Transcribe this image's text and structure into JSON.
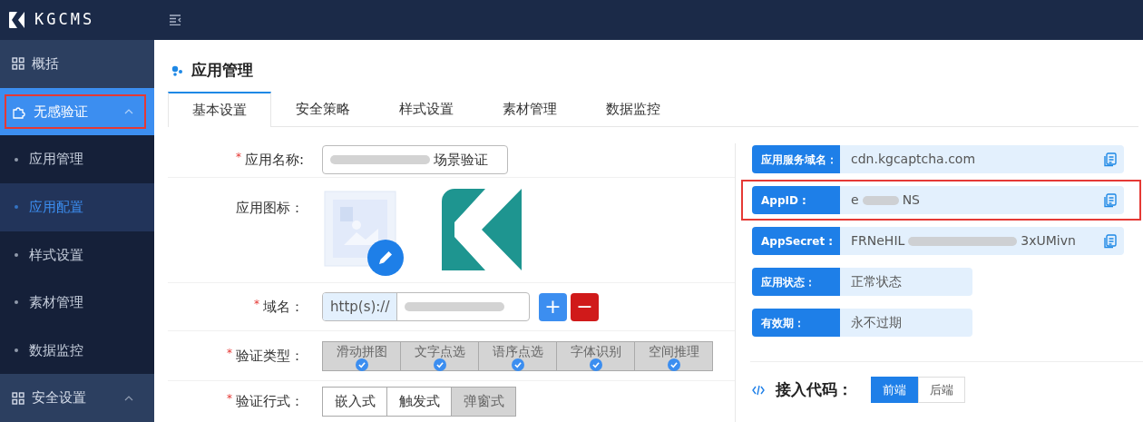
{
  "brand": {
    "name": "KGCMS"
  },
  "sidebar": {
    "items": [
      {
        "label": "概括",
        "kind": "group",
        "selected": false,
        "highlighted": false
      },
      {
        "label": "无感验证",
        "kind": "group",
        "selected": true,
        "expanded": true,
        "highlighted": true,
        "children": [
          {
            "label": "应用管理",
            "selected": false
          },
          {
            "label": "应用配置",
            "selected": true
          },
          {
            "label": "样式设置",
            "selected": false
          },
          {
            "label": "素材管理",
            "selected": false
          },
          {
            "label": "数据监控",
            "selected": false
          }
        ]
      },
      {
        "label": "安全设置",
        "kind": "group",
        "selected": false,
        "expanded": true,
        "highlighted": false
      }
    ]
  },
  "page": {
    "title": "应用管理"
  },
  "tabs": [
    {
      "label": "基本设置",
      "selected": true
    },
    {
      "label": "安全策略",
      "selected": false
    },
    {
      "label": "样式设置",
      "selected": false
    },
    {
      "label": "素材管理",
      "selected": false
    },
    {
      "label": "数据监控",
      "selected": false
    }
  ],
  "form": {
    "name": {
      "label": "应用名称:",
      "required_mark": "*",
      "value_visible": "场景验证"
    },
    "icon": {
      "label": "应用图标："
    },
    "domain": {
      "label": "域名：",
      "required_mark": "*",
      "prefix": "http(s)://",
      "add": "+",
      "remove": "−"
    },
    "types": {
      "label": "验证类型：",
      "required_mark": "*",
      "options": [
        {
          "label": "滑动拼图",
          "checked": true
        },
        {
          "label": "文字点选",
          "checked": true
        },
        {
          "label": "语序点选",
          "checked": true
        },
        {
          "label": "字体识别",
          "checked": true
        },
        {
          "label": "空间推理",
          "checked": true
        }
      ]
    },
    "mode": {
      "label": "验证行式：",
      "required_mark": "*",
      "options": [
        {
          "label": "嵌入式",
          "selected": false
        },
        {
          "label": "触发式",
          "selected": false
        },
        {
          "label": "弹窗式",
          "selected": true
        }
      ]
    }
  },
  "info": [
    {
      "label": "应用服务域名：",
      "start": "cdn.kgcaptcha.com",
      "blurred": false,
      "copy": true,
      "highlighted": false
    },
    {
      "label": "AppID :",
      "start": "e",
      "end": "NS",
      "blurred": true,
      "copy": true,
      "highlighted": true
    },
    {
      "label": "AppSecret :",
      "start": "FRNeHIL",
      "end": "3xUMivn",
      "blurred": true,
      "copy": true,
      "highlighted": false
    },
    {
      "label": "应用状态：",
      "start": "正常状态",
      "blurred": false,
      "copy": false,
      "highlighted": false
    },
    {
      "label": "有效期：",
      "start": "永不过期",
      "blurred": false,
      "copy": false,
      "highlighted": false
    }
  ],
  "code": {
    "title": "接入代码：",
    "options": [
      {
        "label": "前端",
        "selected": true
      },
      {
        "label": "后端",
        "selected": false
      }
    ]
  }
}
